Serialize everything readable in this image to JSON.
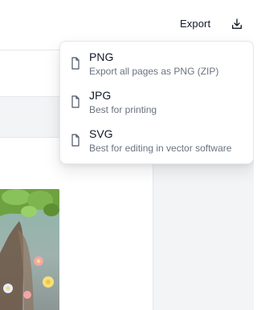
{
  "header": {
    "export_label": "Export",
    "download_icon": "download-icon"
  },
  "export_menu": {
    "items": [
      {
        "label": "PNG",
        "description": "Export all pages as PNG (ZIP)",
        "icon": "file-icon"
      },
      {
        "label": "JPG",
        "description": "Best for printing",
        "icon": "file-icon"
      },
      {
        "label": "SVG",
        "description": "Best for editing in vector software",
        "icon": "file-icon"
      }
    ]
  },
  "colors": {
    "text_primary": "#111827",
    "text_secondary": "#6b7280",
    "border": "#e5e7eb",
    "panel_bg": "#f3f4f6"
  }
}
